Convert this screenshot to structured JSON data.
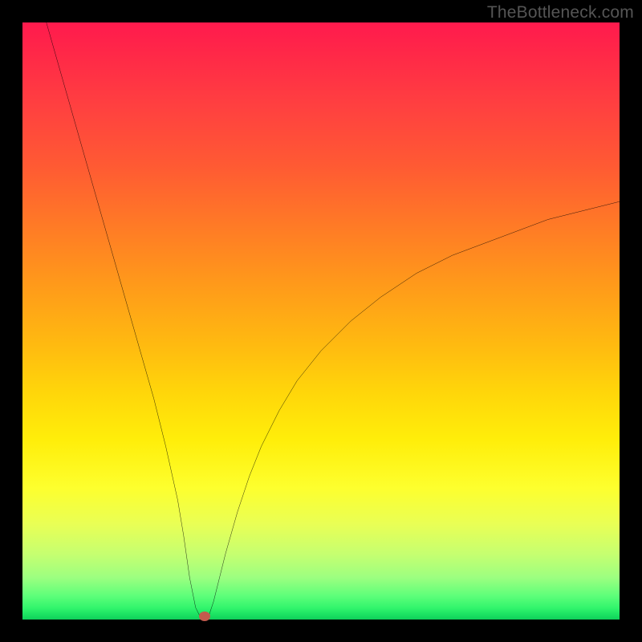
{
  "attribution": "TheBottleneck.com",
  "chart_data": {
    "type": "line",
    "title": "",
    "xlabel": "",
    "ylabel": "",
    "xlim": [
      0,
      100
    ],
    "ylim": [
      0,
      100
    ],
    "gradient_meaning": "top=red (bad), bottom=green (good)",
    "series": [
      {
        "name": "bottleneck-curve",
        "x": [
          4,
          6,
          8,
          10,
          12,
          14,
          16,
          18,
          20,
          22,
          24,
          26,
          27,
          28,
          29,
          30,
          31,
          32,
          34,
          36,
          38,
          40,
          43,
          46,
          50,
          55,
          60,
          66,
          72,
          80,
          88,
          96,
          100
        ],
        "y": [
          100,
          93,
          86,
          79,
          72,
          65,
          58,
          51,
          44,
          37,
          29,
          20,
          14,
          7,
          2,
          0,
          0,
          3,
          11,
          18,
          24,
          29,
          35,
          40,
          45,
          50,
          54,
          58,
          61,
          64,
          67,
          69,
          70
        ]
      }
    ],
    "marker": {
      "x": 30.5,
      "y": 0.5,
      "color": "#c45a4d"
    }
  }
}
